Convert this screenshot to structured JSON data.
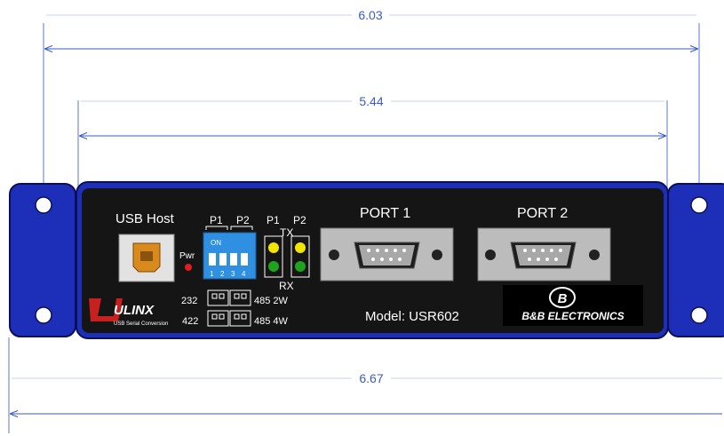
{
  "dimensions": {
    "overall_flange_holes": "6.03",
    "inner_body": "5.44",
    "overall_width": "6.67"
  },
  "panel": {
    "usb_label": "USB Host",
    "pwr_label": "Pwr",
    "dip_header_p1": "P1",
    "dip_header_p2": "P2",
    "dip_on_label": "ON",
    "dip_numbers": [
      "1",
      "2",
      "3",
      "4"
    ],
    "led_header_p1": "P1",
    "led_header_p2": "P2",
    "tx_label": "TX",
    "rx_label": "RX",
    "port1_label": "PORT 1",
    "port2_label": "PORT 2",
    "jumper_232": "232",
    "jumper_422": "422",
    "jumper_485_2w": "485 2W",
    "jumper_485_4w": "485 4W",
    "model_label": "Model: USR602",
    "brand_logo": "ULINX",
    "brand_tagline": "USB Serial Conversion",
    "company_logo_letter": "B",
    "company_name": "B&B ELECTRONICS"
  },
  "colors": {
    "dimension_line": "#3b5bc7",
    "flange": "#1d2fb8",
    "panel": "#151515",
    "dip_switch": "#2f8fe0",
    "led_yellow": "#f2e600",
    "led_green": "#1fa31f",
    "pwr_led": "#e41b1b",
    "usb_port": "#d98a1c"
  }
}
